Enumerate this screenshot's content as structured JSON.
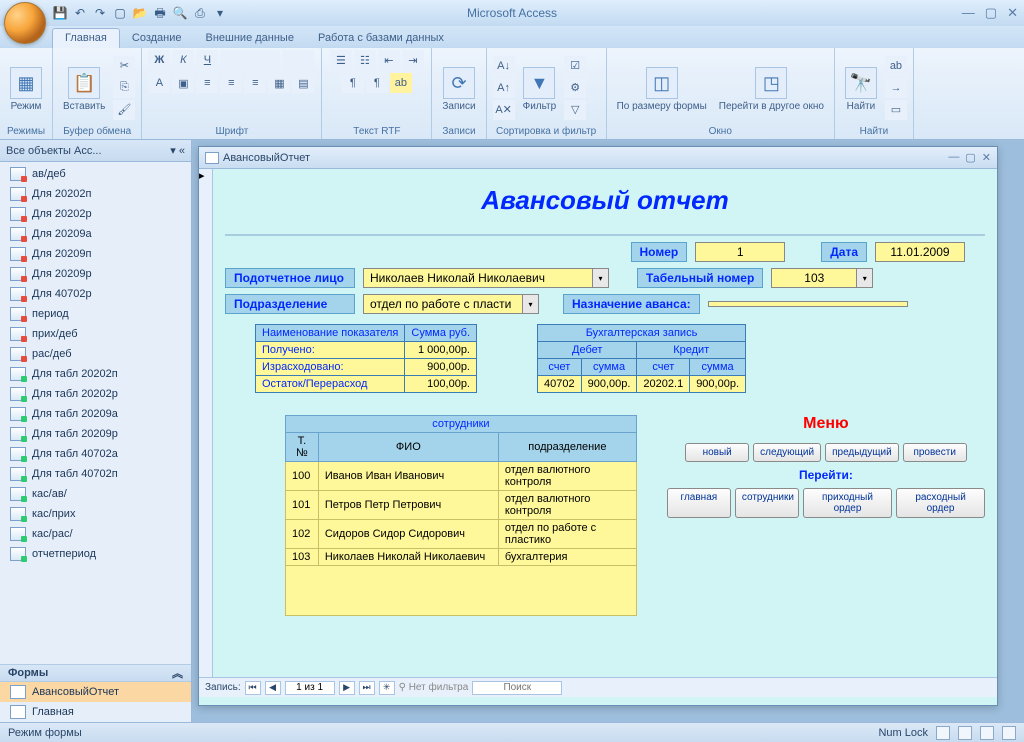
{
  "app": {
    "title": "Microsoft Access"
  },
  "tabs": [
    "Главная",
    "Создание",
    "Внешние данные",
    "Работа с базами данных"
  ],
  "ribbon": {
    "groups": {
      "rezhimy": {
        "label": "Режимы",
        "btn": "Режим"
      },
      "buffer": {
        "label": "Буфер обмена",
        "btn": "Вставить"
      },
      "font": {
        "label": "Шрифт"
      },
      "rtf": {
        "label": "Текст RTF"
      },
      "records": {
        "label": "Записи",
        "btn": "Записи"
      },
      "sort": {
        "label": "Сортировка и фильтр",
        "btn": "Фильтр"
      },
      "window": {
        "label": "Окно",
        "b1": "По размеру формы",
        "b2": "Перейти в другое окно"
      },
      "find": {
        "label": "Найти",
        "btn": "Найти"
      }
    }
  },
  "navpane": {
    "header": "Все объекты Acc...",
    "items": [
      {
        "t": 1,
        "l": "ав/деб"
      },
      {
        "t": 1,
        "l": "Для 20202п"
      },
      {
        "t": 1,
        "l": "Для 20202р"
      },
      {
        "t": 1,
        "l": "Для 20209а"
      },
      {
        "t": 1,
        "l": "Для 20209п"
      },
      {
        "t": 1,
        "l": "Для 20209р"
      },
      {
        "t": 1,
        "l": "Для 40702р"
      },
      {
        "t": 1,
        "l": "период"
      },
      {
        "t": 1,
        "l": "прих/деб"
      },
      {
        "t": 1,
        "l": "рас/деб"
      },
      {
        "t": 2,
        "l": "Для табл 20202п"
      },
      {
        "t": 2,
        "l": "Для табл 20202р"
      },
      {
        "t": 2,
        "l": "Для табл 20209а"
      },
      {
        "t": 2,
        "l": "Для табл 20209р"
      },
      {
        "t": 2,
        "l": "Для табл 40702а"
      },
      {
        "t": 2,
        "l": "Для табл 40702п"
      },
      {
        "t": 2,
        "l": "кас/ав/"
      },
      {
        "t": 2,
        "l": "кас/прих"
      },
      {
        "t": 2,
        "l": "кас/рас/"
      },
      {
        "t": 2,
        "l": "отчетпериод"
      }
    ],
    "section": "Формы",
    "forms": [
      "АвансовыйОтчет",
      "Главная"
    ]
  },
  "form": {
    "wintitle": "АвансовыйОтчет",
    "title": "Авансовый отчет",
    "labels": {
      "nomer": "Номер",
      "data": "Дата",
      "lico": "Подотчетное лицо",
      "tabel": "Табельный номер",
      "podr": "Подразделение",
      "nazn": "Назначение аванса:"
    },
    "values": {
      "nomer": "1",
      "data": "11.01.2009",
      "lico": "Николаев Николай Николаевич",
      "tabel": "103",
      "podr": "отдел по работе с пласти",
      "nazn": ""
    },
    "sumtable": {
      "h1": "Наименование показателя",
      "h2": "Сумма руб.",
      "rows": [
        {
          "n": "Получено:",
          "v": "1 000,00р."
        },
        {
          "n": "Израсходовано:",
          "v": "900,00р."
        },
        {
          "n": "Остаток/Перерасход",
          "v": "100,00р."
        }
      ]
    },
    "acct": {
      "title": "Бухгалтерская запись",
      "debit": "Дебет",
      "credit": "Кредит",
      "cols": [
        "счет",
        "сумма",
        "счет",
        "сумма"
      ],
      "row": [
        "40702",
        "900,00р.",
        "20202.1",
        "900,00р."
      ]
    },
    "emp": {
      "title": "сотрудники",
      "cols": [
        "Т.№",
        "ФИО",
        "подразделение"
      ],
      "rows": [
        {
          "n": "100",
          "f": "Иванов Иван Иванович",
          "p": "отдел валютного контроля"
        },
        {
          "n": "101",
          "f": "Петров Петр Петрович",
          "p": "отдел валютного контроля"
        },
        {
          "n": "102",
          "f": "Сидоров Сидор Сидорович",
          "p": "отдел по работе с пластико"
        },
        {
          "n": "103",
          "f": "Николаев Николай Николаевич",
          "p": "бухгалтерия"
        }
      ]
    },
    "menu": {
      "title": "Меню",
      "row1": [
        "новый",
        "следующий",
        "предыдущий",
        "провести"
      ],
      "sub": "Перейти:",
      "row2": [
        "главная",
        "сотрудники",
        "приходный ордер",
        "расходный ордер"
      ]
    },
    "recnav": {
      "label": "Запись:",
      "pos": "1 из 1",
      "filter": "Нет фильтра",
      "search": "Поиск"
    }
  },
  "status": {
    "left": "Режим формы",
    "right": "Num Lock"
  }
}
